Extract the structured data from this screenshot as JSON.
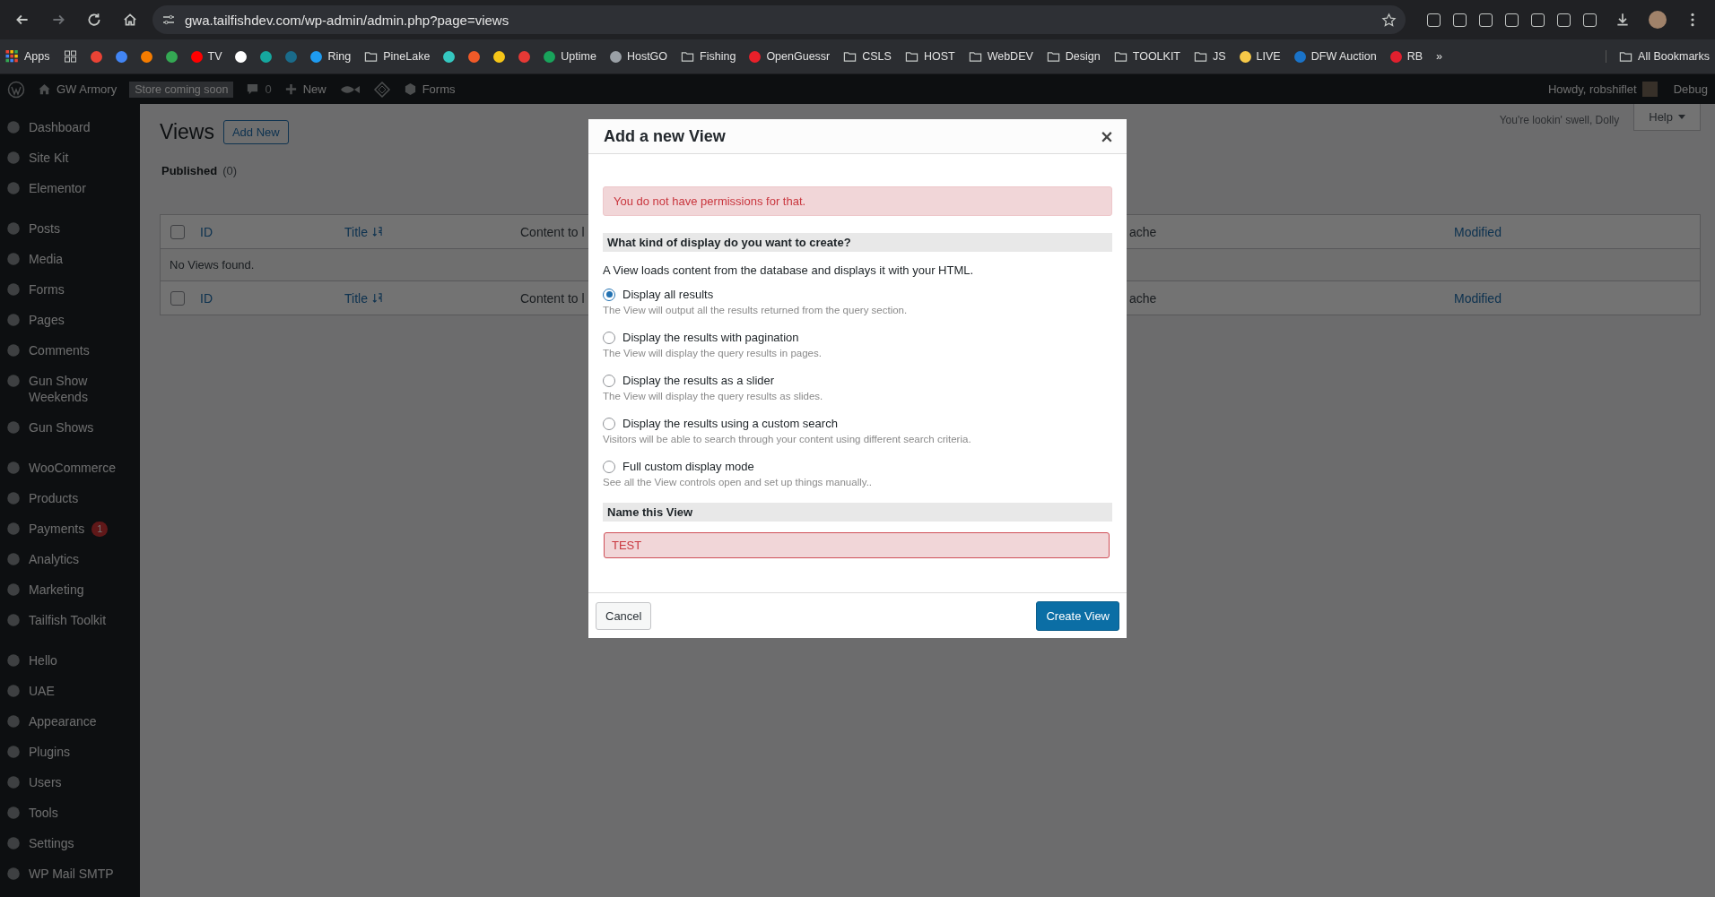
{
  "browser": {
    "url": "gwa.tailfishdev.com/wp-admin/admin.php?page=views",
    "bookmarks": [
      {
        "kind": "apps",
        "label": "Apps"
      },
      {
        "kind": "grid"
      },
      {
        "kind": "site",
        "color": "#ea4335"
      },
      {
        "kind": "site",
        "color": "#4285f4"
      },
      {
        "kind": "site",
        "color": "#f57c00"
      },
      {
        "kind": "site",
        "color": "#34a853"
      },
      {
        "kind": "site",
        "color": "#ff0000",
        "label": "TV"
      },
      {
        "kind": "site",
        "color": "#ffffff"
      },
      {
        "kind": "site",
        "color": "#16a79e"
      },
      {
        "kind": "site",
        "color": "#1a6b8a"
      },
      {
        "kind": "site",
        "color": "#1e9bf0",
        "label": "Ring"
      },
      {
        "kind": "folder",
        "label": "PineLake"
      },
      {
        "kind": "site",
        "color": "#35c7c0"
      },
      {
        "kind": "site",
        "color": "#f05a28"
      },
      {
        "kind": "site",
        "color": "#f5c518"
      },
      {
        "kind": "site",
        "color": "#e53935"
      },
      {
        "kind": "site",
        "color": "#19a35b",
        "label": "Uptime"
      },
      {
        "kind": "site",
        "color": "#9aa0a6",
        "label": "HostGO"
      },
      {
        "kind": "folder",
        "label": "Fishing"
      },
      {
        "kind": "site",
        "color": "#e8202a",
        "label": "OpenGuessr"
      },
      {
        "kind": "folder",
        "label": "CSLS"
      },
      {
        "kind": "folder",
        "label": "HOST"
      },
      {
        "kind": "folder",
        "label": "WebDEV"
      },
      {
        "kind": "folder",
        "label": "Design"
      },
      {
        "kind": "folder",
        "label": "TOOLKIT"
      },
      {
        "kind": "folder",
        "label": "JS"
      },
      {
        "kind": "site",
        "color": "#f7c948",
        "label": "LIVE"
      },
      {
        "kind": "site",
        "color": "#1a73c8",
        "label": "DFW Auction"
      },
      {
        "kind": "site",
        "color": "#e0202e",
        "label": "RB"
      },
      {
        "kind": "more",
        "label": "»"
      }
    ],
    "all_bookmarks": "All Bookmarks"
  },
  "admin_bar": {
    "site": "GW Armory",
    "badge": "Store coming soon",
    "comments": "0",
    "new": "New",
    "forms": "Forms",
    "greeting": "Howdy, robshiflet",
    "debug": "Debug"
  },
  "sidebar": {
    "groups": [
      {
        "items": [
          {
            "label": "Dashboard"
          },
          {
            "label": "Site Kit"
          },
          {
            "label": "Elementor"
          }
        ]
      },
      {
        "items": [
          {
            "label": "Posts"
          },
          {
            "label": "Media"
          },
          {
            "label": "Forms"
          },
          {
            "label": "Pages"
          },
          {
            "label": "Comments"
          },
          {
            "label": "Gun Show Weekends"
          },
          {
            "label": "Gun Shows"
          }
        ]
      },
      {
        "items": [
          {
            "label": "WooCommerce"
          },
          {
            "label": "Products"
          },
          {
            "label": "Payments",
            "badge": "1"
          },
          {
            "label": "Analytics"
          },
          {
            "label": "Marketing"
          },
          {
            "label": "Tailfish Toolkit"
          }
        ]
      },
      {
        "items": [
          {
            "label": "Hello"
          },
          {
            "label": "UAE"
          },
          {
            "label": "Appearance"
          },
          {
            "label": "Plugins"
          },
          {
            "label": "Users"
          },
          {
            "label": "Tools"
          },
          {
            "label": "Settings"
          },
          {
            "label": "WP Mail SMTP"
          }
        ]
      }
    ]
  },
  "page": {
    "dolly": "You're lookin' swell, Dolly",
    "help": "Help",
    "title": "Views",
    "add_new": "Add New",
    "filter": {
      "label": "Published",
      "count": "(0)"
    },
    "table": {
      "header": {
        "checked": false,
        "columns": [
          "ID",
          "Title",
          "Content to l",
          "ache",
          "Modified"
        ]
      },
      "empty": "No Views found.",
      "footer": {
        "checked": false,
        "columns": [
          "ID",
          "Title",
          "Content to l",
          "ache",
          "Modified"
        ]
      }
    }
  },
  "modal": {
    "title": "Add a new View",
    "close": "×",
    "error": "You do not have permissions for that.",
    "kind_heading": "What kind of display do you want to create?",
    "intro": "A View loads content from the database and displays it with your HTML.",
    "options": [
      {
        "label": "Display all results",
        "description": "The View will output all the results returned from the query section.",
        "selected": true
      },
      {
        "label": "Display the results with pagination",
        "description": "The View will display the query results in pages.",
        "selected": false
      },
      {
        "label": "Display the results as a slider",
        "description": "The View will display the query results as slides.",
        "selected": false
      },
      {
        "label": "Display the results using a custom search",
        "description": "Visitors will be able to search through your content using different search criteria.",
        "selected": false
      },
      {
        "label": "Full custom display mode",
        "description": "See all the View controls open and set up things manually..",
        "selected": false
      }
    ],
    "name_heading": "Name this View",
    "name_value": "TEST",
    "cancel": "Cancel",
    "create": "Create View"
  }
}
